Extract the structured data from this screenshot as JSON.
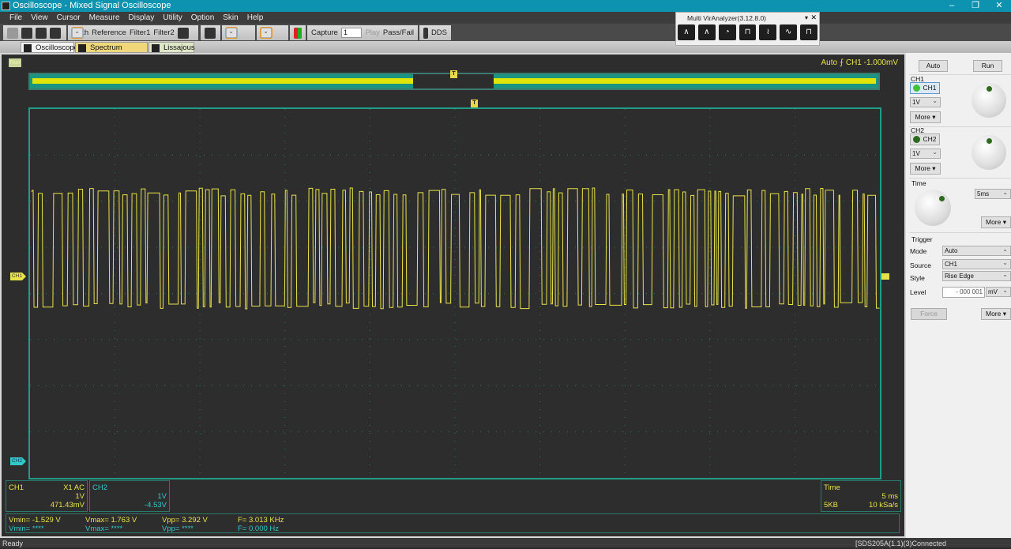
{
  "window": {
    "title": "Oscilloscope - Mixed Signal Oscilloscope",
    "controls": [
      "–",
      "❐",
      "✕"
    ]
  },
  "menu": [
    "File",
    "View",
    "Cursor",
    "Measure",
    "Display",
    "Utility",
    "Option",
    "Skin",
    "Help"
  ],
  "toolbar": {
    "math": "Math",
    "reference": "Reference",
    "filter1": "Filter1",
    "filter2": "Filter2",
    "capture": "Capture",
    "capture_value": "1",
    "play": "Play",
    "passfail": "Pass/Fail",
    "dds": "DDS"
  },
  "tabs": [
    "Oscilloscope",
    "Spectrum Analyzer",
    "Lissajous"
  ],
  "virtual_analyzer": {
    "title": "Multi VirAnalyzer(3.12.8.0)"
  },
  "scope": {
    "run_label": "Run",
    "trigger_status": "Auto  ⨍ CH1 -1.000mV",
    "trigger_marker": "T",
    "ch1_marker": "CH1",
    "ch2_marker": "CH2"
  },
  "ch1_info": {
    "name": "CH1",
    "probe": "X1  AC",
    "scale": "1V",
    "offset": "471.43mV"
  },
  "ch2_info": {
    "name": "CH2",
    "scale": "1V",
    "offset": "-4.53V"
  },
  "time_info": {
    "label": "Time",
    "scale": "5 ms",
    "depth": "5KB",
    "rate": "10 kSa/s"
  },
  "measurements": {
    "ch1": {
      "vmin": "Vmin= -1.529 V",
      "vmax": "Vmax= 1.763 V",
      "vpp": "Vpp= 3.292 V",
      "f": "F= 3.013 KHz"
    },
    "ch2": {
      "vmin": "Vmin= ****",
      "vmax": "Vmax= ****",
      "vpp": "Vpp= ****",
      "f": "F= 0.000 Hz"
    }
  },
  "panel": {
    "auto": "Auto",
    "run": "Run",
    "ch1_label": "CH1",
    "ch1_btn": "CH1",
    "ch1_volt": "1V",
    "more": "More  ▾",
    "ch2_label": "CH2",
    "ch2_btn": "CH2",
    "ch2_volt": "1V",
    "time_label": "Time",
    "time_value": "5ms",
    "trigger_label": "Trigger",
    "mode_label": "Mode",
    "mode_value": "Auto",
    "source_label": "Source",
    "source_value": "CH1",
    "style_label": "Style",
    "style_value": "Rise Edge",
    "level_label": "Level",
    "level_value": "- 000 001",
    "level_unit": "mV",
    "force": "Force"
  },
  "status": {
    "left": "Ready",
    "right": "[SDS205A(1.1)(3)Connected"
  },
  "colors": {
    "ch1": "#e8e24a",
    "ch2": "#32c8c8",
    "grid": "#1f9c88"
  }
}
